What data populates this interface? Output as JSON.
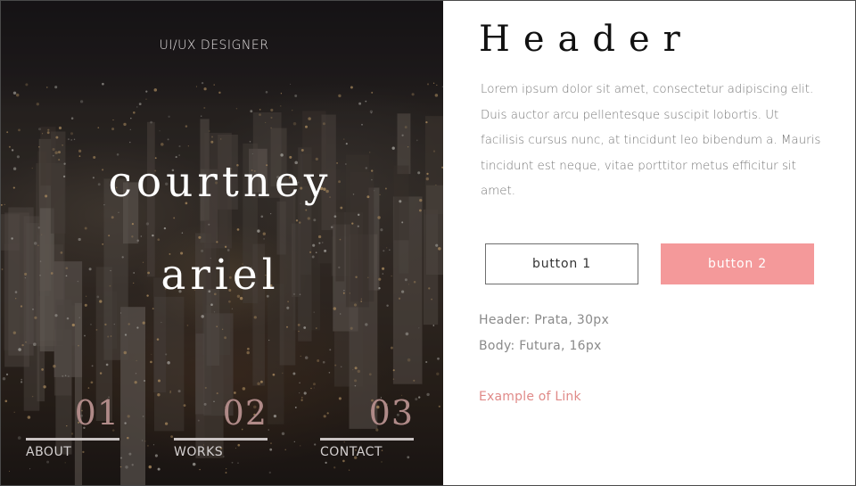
{
  "hero": {
    "role": "UI/UX DESIGNER",
    "first_name": "courtney",
    "last_name": "ariel",
    "nav": [
      {
        "number": "01",
        "label": "ABOUT"
      },
      {
        "number": "02",
        "label": "WORKS"
      },
      {
        "number": "03",
        "label": "CONTACT"
      }
    ]
  },
  "content": {
    "header": "Header",
    "body": "Lorem ipsum dolor sit amet, consectetur adipiscing elit. Duis auctor arcu pellentesque suscipit lobortis. Ut facilisis cursus nunc, at tincidunt leo bibendum a. Mauris tincidunt est neque, vitae porttitor metus efficitur sit amet.",
    "button1": "button 1",
    "button2": "button 2",
    "spec_header": "Header: Prata, 30px",
    "spec_body": "Body: Futura, 16px",
    "link": "Example of Link"
  },
  "colors": {
    "accent": "#f4999a",
    "link": "#e08a88",
    "nav_number": "#b08a88"
  }
}
